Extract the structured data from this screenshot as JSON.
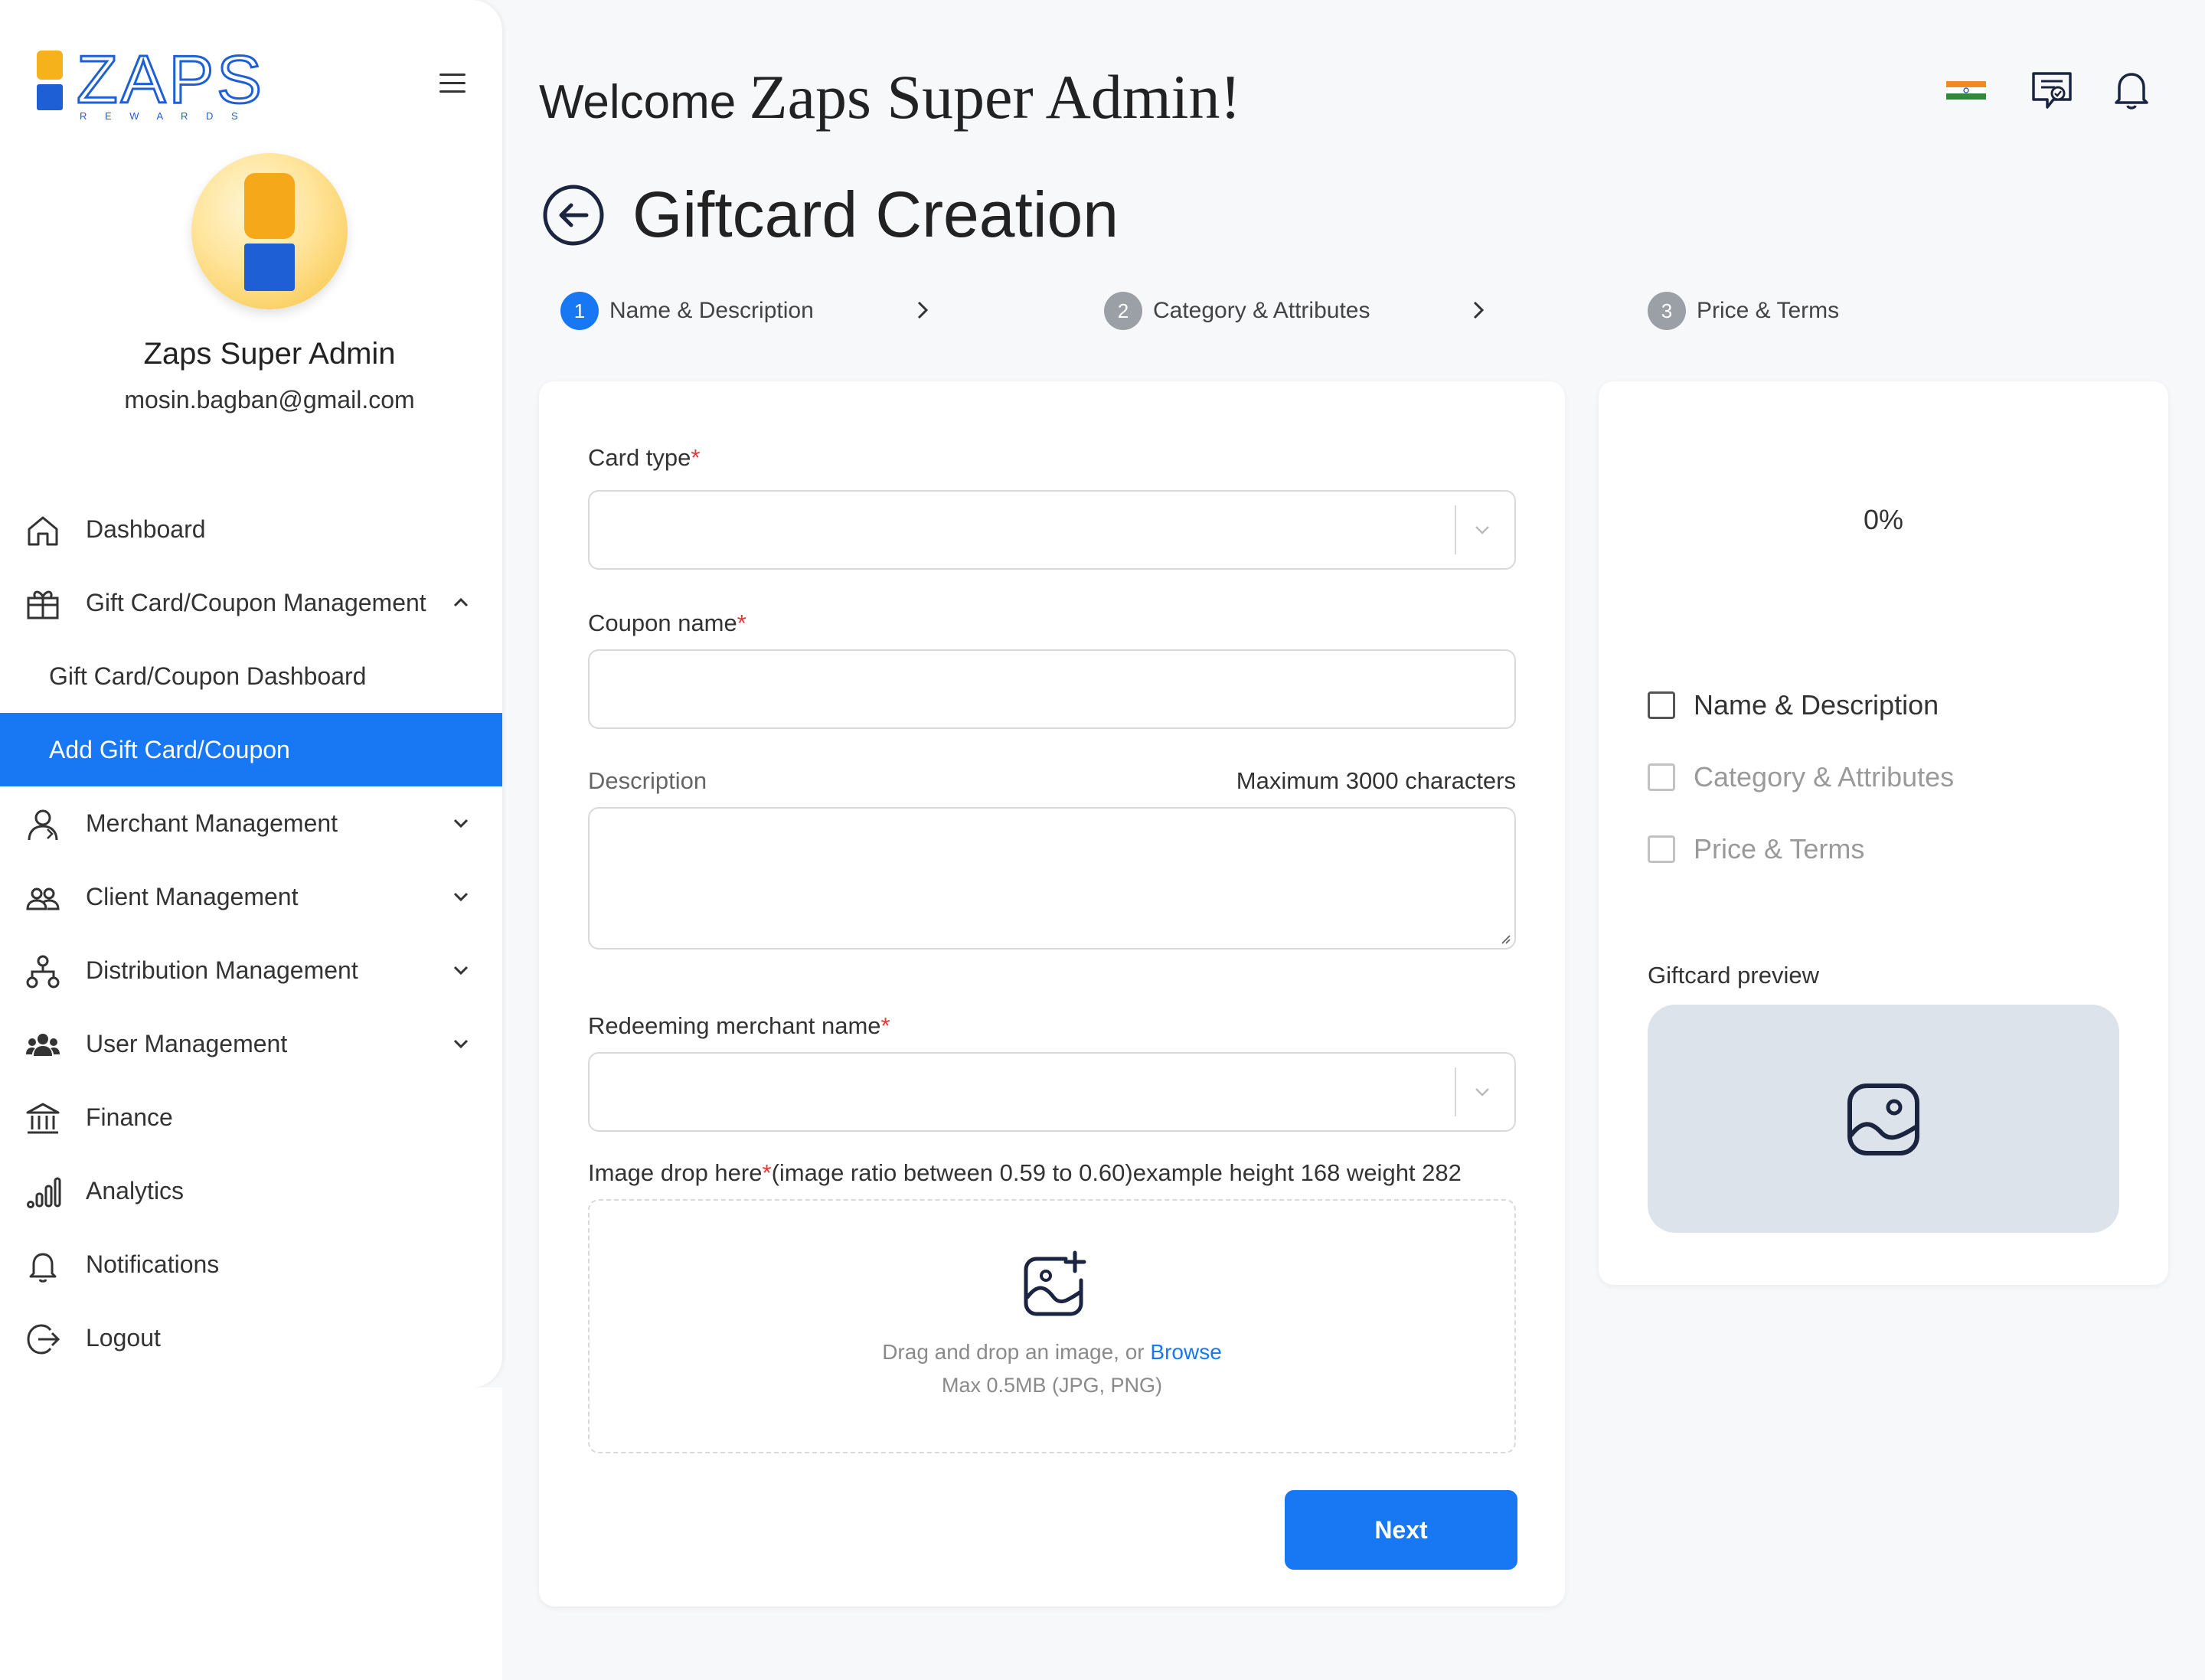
{
  "brand": {
    "logo_text": "ZAPS",
    "logo_subtext": "R E W A R D S",
    "accent": "#1877f2"
  },
  "profile": {
    "name": "Zaps Super Admin",
    "email": "mosin.bagban@gmail.com"
  },
  "sidebar": {
    "items": [
      {
        "label": "Dashboard",
        "icon": "home-icon"
      },
      {
        "label": "Gift Card/Coupon Management",
        "icon": "gift-icon",
        "expanded": true
      },
      {
        "label": "Merchant Management",
        "icon": "merchant-icon"
      },
      {
        "label": "Client Management",
        "icon": "users-icon"
      },
      {
        "label": "Distribution Management",
        "icon": "hierarchy-icon"
      },
      {
        "label": "User Management",
        "icon": "group-icon"
      },
      {
        "label": "Finance",
        "icon": "bank-icon"
      },
      {
        "label": "Analytics",
        "icon": "bar-chart-icon"
      },
      {
        "label": "Notifications",
        "icon": "bell-icon"
      },
      {
        "label": "Logout",
        "icon": "logout-icon"
      }
    ],
    "sub_items": [
      {
        "label": "Gift Card/Coupon Dashboard",
        "active": false
      },
      {
        "label": "Add Gift Card/Coupon",
        "active": true
      }
    ]
  },
  "header": {
    "welcome_prefix": "Welcome",
    "welcome_name": "Zaps Super Admin!",
    "page_title": "Giftcard Creation"
  },
  "steps": [
    {
      "number": "1",
      "label": "Name & Description",
      "current": true
    },
    {
      "number": "2",
      "label": "Category & Attributes",
      "current": false
    },
    {
      "number": "3",
      "label": "Price & Terms",
      "current": false
    }
  ],
  "form": {
    "card_type": {
      "label": "Card type",
      "required_mark": "*",
      "value": ""
    },
    "coupon_name": {
      "label": "Coupon name",
      "required_mark": "*",
      "value": ""
    },
    "description": {
      "label": "Description",
      "limit_text": "Maximum 3000 characters",
      "value": ""
    },
    "redeeming_merchant": {
      "label": "Redeeming merchant name",
      "required_mark": "*",
      "value": ""
    },
    "image": {
      "label": "Image drop here",
      "required_mark": "*",
      "label_note": "(image ratio between 0.59 to 0.60)example height 168 weight 282",
      "drop_text": "Drag and drop an image, or",
      "browse_text": "Browse",
      "hint": "Max 0.5MB (JPG, PNG)"
    },
    "next_label": "Next"
  },
  "progress": {
    "percent_text": "0%",
    "percent": 0,
    "checklist": [
      {
        "label": "Name & Description",
        "checked": false
      },
      {
        "label": "Category & Attributes",
        "checked": false
      },
      {
        "label": "Price & Terms",
        "checked": false
      }
    ],
    "preview_label": "Giftcard preview"
  }
}
